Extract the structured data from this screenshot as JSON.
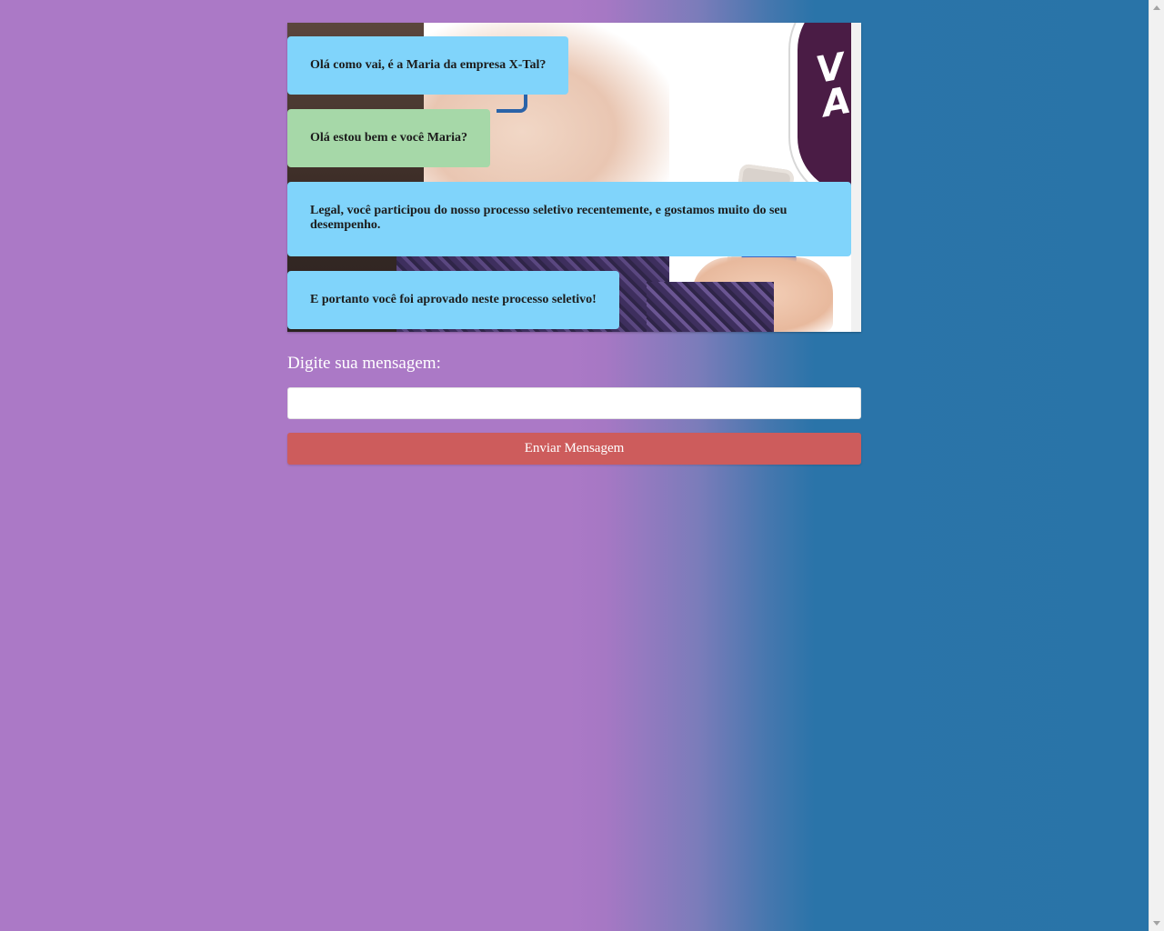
{
  "chat": {
    "messages": [
      {
        "sender": "received",
        "text": "Olá como vai, é a Maria da empresa X-Tal?"
      },
      {
        "sender": "sent",
        "text": "Olá estou bem e você Maria?"
      },
      {
        "sender": "received",
        "text": "Legal, você participou do nosso processo seletivo recentemente, e gostamos muito do seu desempenho."
      },
      {
        "sender": "received",
        "text": "E portanto você foi aprovado neste processo seletivo!"
      }
    ],
    "background_text": "V\nAl"
  },
  "form": {
    "label": "Digite sua mensagem:",
    "input_value": "",
    "input_placeholder": "",
    "send_label": "Enviar Mensagem"
  },
  "colors": {
    "received_bubble": "#80d4fb",
    "sent_bubble": "#a6d8a8",
    "send_button": "#cd5c5c",
    "background_left": "#ab79c6",
    "background_right": "#2974a8"
  }
}
